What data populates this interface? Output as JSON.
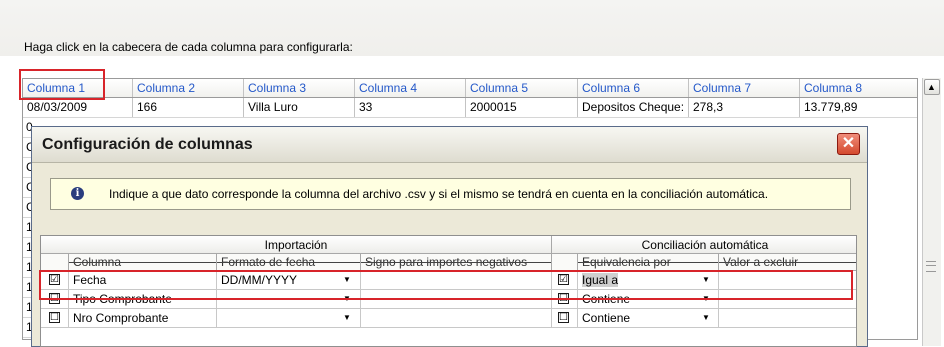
{
  "instruction": "Haga click en la cabecera de cada columna para configurarla:",
  "grid": {
    "headers": [
      "Columna 1",
      "Columna 2",
      "Columna 3",
      "Columna 4",
      "Columna 5",
      "Columna 6",
      "Columna 7",
      "Columna 8"
    ],
    "first_row": [
      "08/03/2009",
      "166",
      "Villa Luro",
      "33",
      "2000015",
      "Depositos Cheque:",
      "278,3",
      "13.779,89"
    ],
    "row_stubs": [
      "0",
      "C",
      "C",
      "C",
      "C",
      "1",
      "1",
      "1",
      "1",
      "1",
      "1"
    ]
  },
  "dialog": {
    "title": "Configuración de columnas",
    "close_glyph": "✕",
    "info_glyph": "i",
    "info_text": "Indique a que dato corresponde la columna del archivo .csv y si el mismo se tendrá en cuenta en la conciliación automática.",
    "group_importacion": "Importación",
    "group_conciliacion": "Conciliación automática",
    "col_columna": "Columna",
    "col_formato": "Formato de fecha",
    "col_signo": "Signo para importes negativos",
    "col_equivalencia": "Equivalencia por",
    "col_valor": "Valor a excluir",
    "rows": [
      {
        "checked": "☑",
        "name": "Fecha",
        "formato": "DD/MM/YYYY",
        "check2": "☑",
        "equivalencia": "Igual a"
      },
      {
        "checked": "☐",
        "name": "Tipo Comprobante",
        "formato": "",
        "check2": "☐",
        "equivalencia": "Contiene"
      },
      {
        "checked": "☐",
        "name": "Nro Comprobante",
        "formato": "",
        "check2": "☐",
        "equivalencia": "Contiene"
      }
    ],
    "dropdown_glyph": "▼"
  },
  "scroll": {
    "up_glyph": "▲"
  },
  "highlight_color": "#d8242a"
}
